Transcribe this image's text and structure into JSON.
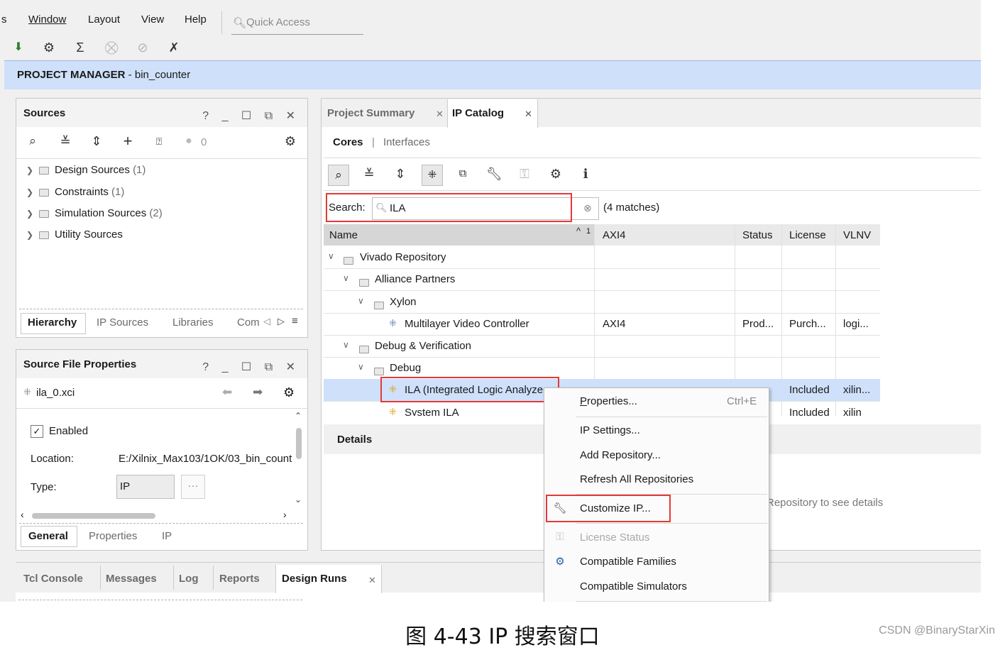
{
  "menubar": {
    "cut_item": "s",
    "items": [
      "Window",
      "Layout",
      "View",
      "Help"
    ],
    "quick_access_placeholder": "Quick Access"
  },
  "toolbar": {
    "icons": [
      "run-icon",
      "gear-icon",
      "sigma-icon",
      "disabled-icon",
      "disabled-icon-2",
      "cross-tool-icon"
    ]
  },
  "project_manager": {
    "title": "PROJECT MANAGER",
    "separator": " - ",
    "project": "bin_counter"
  },
  "sources_panel": {
    "title": "Sources",
    "controls": "? _ ☐ ⧉ ✕",
    "badge_count": "0",
    "items": [
      {
        "label": "Design Sources",
        "count": "(1)"
      },
      {
        "label": "Constraints",
        "count": "(1)"
      },
      {
        "label": "Simulation Sources",
        "count": "(2)"
      },
      {
        "label": "Utility Sources",
        "count": ""
      }
    ],
    "tabs": [
      "Hierarchy",
      "IP Sources",
      "Libraries",
      "Com"
    ]
  },
  "properties_panel": {
    "title": "Source File Properties",
    "file": "ila_0.xci",
    "enabled_label": "Enabled",
    "location_label": "Location:",
    "location_value": "E:/Xilnix_Max103/1OK/03_bin_count",
    "type_label": "Type:",
    "type_value": "IP",
    "ellipsis": "···",
    "tabs": [
      "General",
      "Properties",
      "IP"
    ]
  },
  "catalog": {
    "doc_tabs": [
      "Project Summary",
      "IP Catalog"
    ],
    "sub_tabs": [
      "Cores",
      "Interfaces"
    ],
    "search_label": "Search:",
    "search_value": "ILA",
    "matches": "(4 matches)",
    "columns": [
      "Name",
      "AXI4",
      "Status",
      "License",
      "VLNV"
    ],
    "sort_indicator": "1",
    "rows": [
      {
        "name": "Vivado Repository",
        "axi": "",
        "status": "",
        "license": "",
        "vlnv": ""
      },
      {
        "name": "Alliance Partners",
        "axi": "",
        "status": "",
        "license": "",
        "vlnv": ""
      },
      {
        "name": "Xylon",
        "axi": "",
        "status": "",
        "license": "",
        "vlnv": ""
      },
      {
        "name": "Multilayer Video Controller",
        "axi": "AXI4",
        "status": "Prod...",
        "license": "Purch...",
        "vlnv": "logi..."
      },
      {
        "name": "Debug & Verification",
        "axi": "",
        "status": "",
        "license": "",
        "vlnv": ""
      },
      {
        "name": "Debug",
        "axi": "",
        "status": "",
        "license": "",
        "vlnv": ""
      },
      {
        "name": "ILA (Integrated Logic Analyzer)",
        "axi": "",
        "status": "",
        "license": "Included",
        "vlnv": "xilin..."
      },
      {
        "name": "System ILA",
        "axi": "",
        "status": "",
        "license": "Included",
        "vlnv": "xilin"
      }
    ],
    "details_title": "Details",
    "details_hint": "Repository to see details"
  },
  "context_menu": {
    "properties": "Properties...",
    "properties_shortcut": "Ctrl+E",
    "ip_settings": "IP Settings...",
    "add_repository": "Add Repository...",
    "refresh": "Refresh All Repositories",
    "customize": "Customize IP...",
    "license_status": "License Status",
    "families": "Compatible Families",
    "simulators": "Compatible Simulators"
  },
  "bottom_tabs": [
    "Tcl Console",
    "Messages",
    "Log",
    "Reports",
    "Design Runs"
  ],
  "caption": "图  4-43 IP 搜索窗口",
  "watermark": "CSDN @BinaryStarXin",
  "colors": {
    "selection": "#cfe0fa",
    "highlight_box": "#e53935",
    "header_bar": "#cfe0fa"
  }
}
